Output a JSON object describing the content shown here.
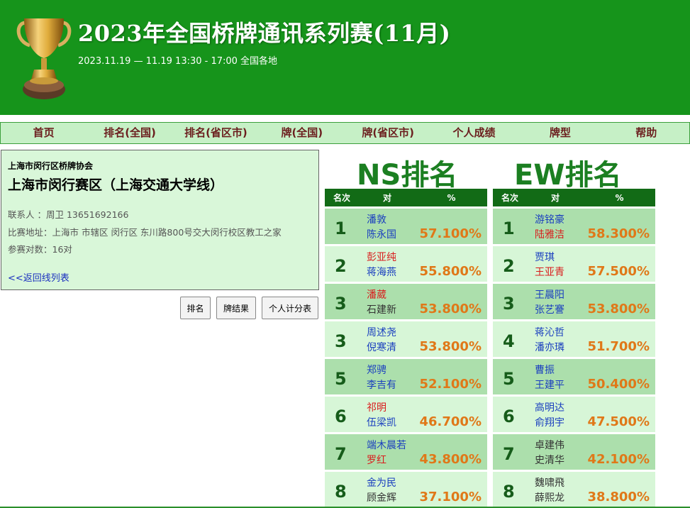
{
  "header": {
    "title": "2023年全国桥牌通讯系列赛(11月)",
    "subtitle": "2023.11.19 — 11.19   13:30 - 17:00   全国各地"
  },
  "nav": [
    "首页",
    "排名(全国)",
    "排名(省区市)",
    "牌(全国)",
    "牌(省区市)",
    "个人成绩",
    "牌型",
    "帮助"
  ],
  "info": {
    "org": "上海市闵行区桥牌协会",
    "venue": "上海市闵行赛区（上海交通大学线）",
    "contact": "联系人    ：周卫 13651692166",
    "address": "比赛地址：上海市 市辖区 闵行区 东川路800号交大闵行校区教工之家",
    "pairs": "参赛对数：16对",
    "back": "<<返回线列表"
  },
  "buttons": [
    "排名",
    "牌结果",
    "个人计分表"
  ],
  "ns": {
    "title": "NS排名",
    "headers": [
      "名次",
      "对",
      "%"
    ],
    "rows": [
      {
        "rank": "1",
        "p1": "潘敦",
        "p1c": "blue",
        "p2": "陈永国",
        "p2c": "blue",
        "pct": "57.100%"
      },
      {
        "rank": "2",
        "p1": "彭亚纯",
        "p1c": "red",
        "p2": "蒋海燕",
        "p2c": "blue",
        "pct": "55.800%"
      },
      {
        "rank": "3",
        "p1": "潘葳",
        "p1c": "red",
        "p2": "石建新",
        "p2c": "black",
        "pct": "53.800%"
      },
      {
        "rank": "3",
        "p1": "周述尧",
        "p1c": "blue",
        "p2": "倪寒清",
        "p2c": "blue",
        "pct": "53.800%"
      },
      {
        "rank": "5",
        "p1": "郑骋",
        "p1c": "blue",
        "p2": "李吉有",
        "p2c": "blue",
        "pct": "52.100%"
      },
      {
        "rank": "6",
        "p1": "祁明",
        "p1c": "red",
        "p2": "伍梁凯",
        "p2c": "blue",
        "pct": "46.700%"
      },
      {
        "rank": "7",
        "p1": "端木晨若",
        "p1c": "blue",
        "p2": "罗红",
        "p2c": "red",
        "pct": "43.800%"
      },
      {
        "rank": "8",
        "p1": "金为民",
        "p1c": "blue",
        "p2": "顾金辉",
        "p2c": "black",
        "pct": "37.100%"
      }
    ]
  },
  "ew": {
    "title": "EW排名",
    "headers": [
      "名次",
      "对",
      "%"
    ],
    "rows": [
      {
        "rank": "1",
        "p1": "游铭豪",
        "p1c": "blue",
        "p2": "陆雅洁",
        "p2c": "red",
        "pct": "58.300%"
      },
      {
        "rank": "2",
        "p1": "贾琪",
        "p1c": "blue",
        "p2": "王亚青",
        "p2c": "red",
        "pct": "57.500%"
      },
      {
        "rank": "3",
        "p1": "王晨阳",
        "p1c": "blue",
        "p2": "张艺謇",
        "p2c": "blue",
        "pct": "53.800%"
      },
      {
        "rank": "4",
        "p1": "蒋沁哲",
        "p1c": "blue",
        "p2": "潘亦璘",
        "p2c": "blue",
        "pct": "51.700%"
      },
      {
        "rank": "5",
        "p1": "曹振",
        "p1c": "blue",
        "p2": "王建平",
        "p2c": "blue",
        "pct": "50.400%"
      },
      {
        "rank": "6",
        "p1": "高明达",
        "p1c": "blue",
        "p2": "俞翔宇",
        "p2c": "blue",
        "pct": "47.500%"
      },
      {
        "rank": "7",
        "p1": "卓建伟",
        "p1c": "black",
        "p2": "史清华",
        "p2c": "black",
        "pct": "42.100%"
      },
      {
        "rank": "8",
        "p1": "魏啸飛",
        "p1c": "black",
        "p2": "薛熙龙",
        "p2c": "black",
        "pct": "38.800%"
      }
    ]
  }
}
